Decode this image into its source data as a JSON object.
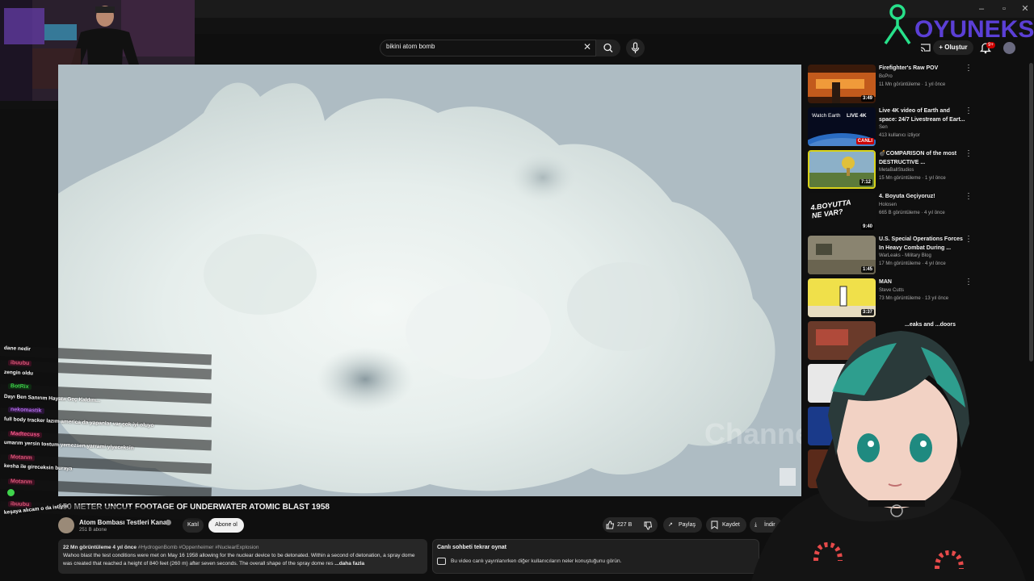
{
  "search": {
    "query": "bikini atom bomb"
  },
  "header": {
    "create_label": "Oluştur",
    "notif_count": "9+",
    "logo_text": "OYUNEKS"
  },
  "video": {
    "title": "150 METER UNCUT FOOTAGE OF UNDERWATER ATOMIC BLAST 1958",
    "watermark": "Channel",
    "channel": {
      "name": "Atom Bombası Testleri Kanalı",
      "subs": "251 B abone",
      "join_label": "Katıl",
      "subscribe_label": "Abone ol"
    },
    "actions": {
      "likes": "227 B",
      "share_label": "Paylaş",
      "save_label": "Kaydet",
      "download_label": "İndir"
    },
    "description": {
      "meta": "22 Mn görüntüleme  4 yıl önce",
      "tags": "#HydrogenBomb #Oppenheimer #NuclearExplosion",
      "text": "Wahoo blast the test conditions were met on May 16 1958 allowing for the nuclear device to be detonated. Within a second of detonation, a spray dome was created that reached a height of 840 feet (260 m) after seven seconds. The overall shape of the spray dome res",
      "more_label": "...daha fazla"
    },
    "chat_replay": {
      "title": "Canlı sohbeti tekrar oynat",
      "text": "Bu video canlı yayınlanırken diğer kullanıcıların neler konuştuğunu görün."
    }
  },
  "recommendations": [
    {
      "title": "Firefighter's Raw POV",
      "channel": "BoPro",
      "stats": "11 Mn görüntüleme · 1 yıl önce",
      "duration": "3:49",
      "color": "#b3501c"
    },
    {
      "title": "Live 4K video of Earth and space: 24/7 Livestream of Eart...",
      "channel": "Sen",
      "stats": "413 kullanıcı izliyor",
      "duration": "CANLI",
      "thumb_text": "Watch Earth",
      "thumb_tag": "LIVE 4K",
      "color": "#0c1a3a"
    },
    {
      "title": "💣COMPARISON of the most DESTRUCTIVE ...",
      "channel": "MetaBallStudios",
      "stats": "15 Mn görüntüleme · 1 yıl önce",
      "duration": "7:12",
      "color": "#6a8a4a"
    },
    {
      "title": "4. Boyuta Geçiyoruz!",
      "channel": "Holosen",
      "stats": "665 B görüntüleme · 4 yıl önce",
      "duration": "9:40",
      "thumb_text": "4.BOYUTTA NE VAR?",
      "color": "#111111"
    },
    {
      "title": "U.S. Special Operations Forces In Heavy Combat During ...",
      "channel": "WarLeaks - Military Blog",
      "stats": "17 Mn görüntüleme · 4 yıl önce",
      "duration": "1:45",
      "color": "#7a7560"
    },
    {
      "title": "MAN",
      "channel": "Steve Cutts",
      "stats": "73 Mn görüntüleme · 13 yıl önce",
      "duration": "3:37",
      "color": "#e8d84a"
    },
    {
      "title": "...eaks and ...doors",
      "channel": "",
      "stats": "",
      "duration": "",
      "color": "#7a3a2a"
    }
  ],
  "chat": [
    {
      "name": "",
      "name_color": "",
      "msg": "dane nedir"
    },
    {
      "name": "ibuubu",
      "name_color": "#e0567a",
      "msg": "zengin oldu"
    },
    {
      "name": "BotRix",
      "name_color": "#3fd34b",
      "msg": "Dayı Ben Sanırım Hayata Geç Kaldım..."
    },
    {
      "name": "nekomastik",
      "name_color": "#b66ef0",
      "msg": "full body tracker lazım america da yapanlar var çok iyi oluyo"
    },
    {
      "name": "Madtecuss",
      "name_color": "#ff5b8f",
      "msg": "umarım yersin tostum yemezsen yarrami yiyeceksin"
    },
    {
      "name": "Motanm",
      "name_color": "#e0567a",
      "msg": "kesha ile gireceksin buraya"
    },
    {
      "name": "Motanm",
      "name_color": "#e0567a",
      "msg": ""
    },
    {
      "name": "ibuubu",
      "name_color": "#e0567a",
      "msg": "keşaya alıcam o da istiyor"
    }
  ]
}
